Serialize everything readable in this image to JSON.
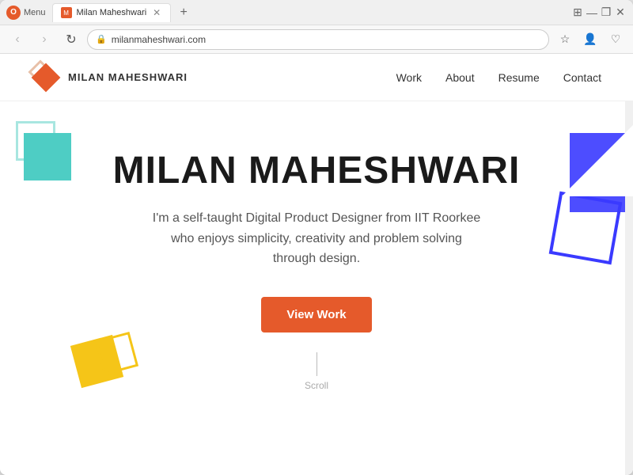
{
  "browser": {
    "menu_label": "Menu",
    "tab_title": "Milan Maheshwari",
    "new_tab_label": "+",
    "address": "milanmaheshwari.com",
    "window_controls": {
      "minimize": "—",
      "maximize": "❐",
      "close": "✕"
    },
    "nav": {
      "back": "‹",
      "forward": "›",
      "refresh": "↻"
    }
  },
  "site": {
    "logo_text": "MILAN MAHESHWARI",
    "nav_links": [
      {
        "label": "Work",
        "id": "work"
      },
      {
        "label": "About",
        "id": "about"
      },
      {
        "label": "Resume",
        "id": "resume"
      },
      {
        "label": "Contact",
        "id": "contact"
      }
    ],
    "hero": {
      "title": "MILAN MAHESHWARI",
      "subtitle": "I'm a self-taught Digital Product Designer from IIT Roorkee who enjoys simplicity, creativity and problem solving through design.",
      "cta_button": "View Work",
      "scroll_label": "Scroll"
    }
  },
  "colors": {
    "brand_orange": "#e55a2b",
    "teal": "#4ecdc4",
    "yellow": "#f5c518",
    "blue": "#3a3aff"
  }
}
